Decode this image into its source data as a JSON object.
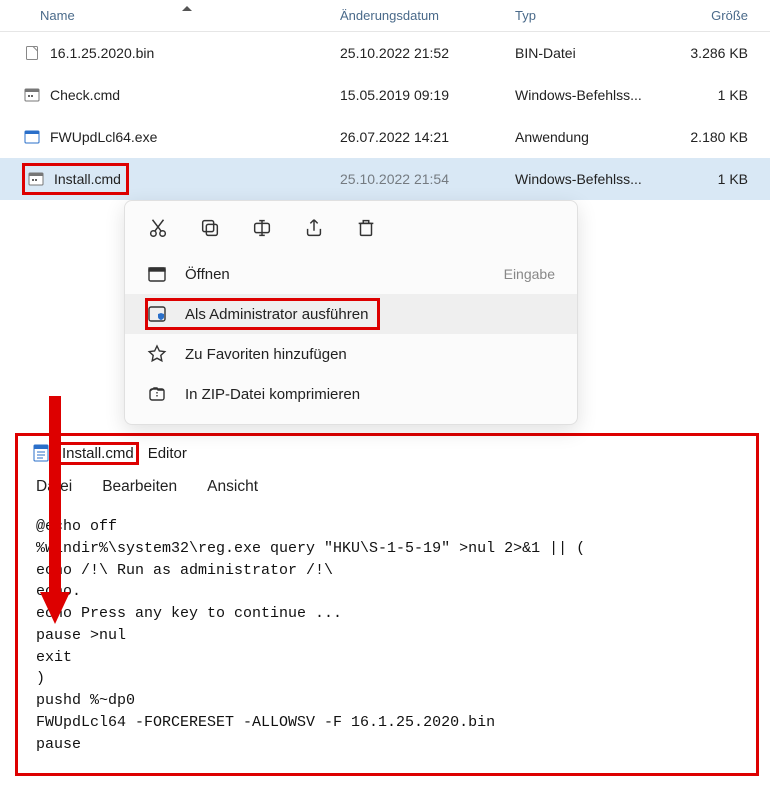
{
  "columns": {
    "name": "Name",
    "date": "Änderungsdatum",
    "type": "Typ",
    "size": "Größe"
  },
  "files": [
    {
      "name": "16.1.25.2020.bin",
      "date": "25.10.2022 21:52",
      "type": "BIN-Datei",
      "size": "3.286 KB",
      "icon": "file"
    },
    {
      "name": "Check.cmd",
      "date": "15.05.2019 09:19",
      "type": "Windows-Befehlss...",
      "size": "1 KB",
      "icon": "cmd"
    },
    {
      "name": "FWUpdLcl64.exe",
      "date": "26.07.2022 14:21",
      "type": "Anwendung",
      "size": "2.180 KB",
      "icon": "exe"
    },
    {
      "name": "Install.cmd",
      "date": "25.10.2022 21:54",
      "type": "Windows-Befehlss...",
      "size": "1 KB",
      "icon": "cmd"
    }
  ],
  "ctx": {
    "open": "Öffnen",
    "openHint": "Eingabe",
    "admin": "Als Administrator ausführen",
    "fav": "Zu Favoriten hinzufügen",
    "zip": "In ZIP-Datei komprimieren"
  },
  "notepad": {
    "file": "Install.cmd",
    "app": "Editor",
    "menu": {
      "file": "Datei",
      "edit": "Bearbeiten",
      "view": "Ansicht"
    },
    "content": "@echo off\n%windir%\\system32\\reg.exe query \"HKU\\S-1-5-19\" >nul 2>&1 || (\necho /!\\ Run as administrator /!\\\necho.\necho Press any key to continue ...\npause >nul\nexit\n)\npushd %~dp0\nFWUpdLcl64 -FORCERESET -ALLOWSV -F 16.1.25.2020.bin\npause"
  }
}
